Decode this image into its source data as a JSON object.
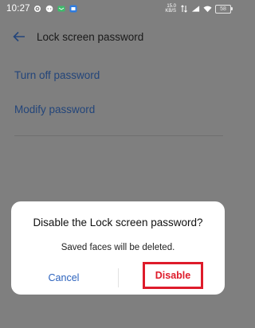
{
  "status_bar": {
    "time": "10:27",
    "net_speed_value": "15.0",
    "net_speed_unit": "KB/S",
    "battery": "58",
    "icons": [
      "settings-icon",
      "chat-icon",
      "message-icon",
      "app-icon",
      "network-speed-icon",
      "mobile-data-icon",
      "signal-icon",
      "wifi-icon",
      "battery-icon"
    ]
  },
  "header": {
    "title": "Lock screen password",
    "back_icon": "back-arrow-icon"
  },
  "menu": {
    "items": [
      {
        "label": "Turn off password"
      },
      {
        "label": "Modify password"
      }
    ]
  },
  "dialog": {
    "title": "Disable the Lock screen password?",
    "message": "Saved faces will be deleted.",
    "cancel_label": "Cancel",
    "disable_label": "Disable"
  },
  "colors": {
    "overlay": "#7f7f7f",
    "link_blue": "#23457a",
    "cancel_blue": "#2b62bd",
    "disable_red": "#de1b2a",
    "highlight_border": "#de1b2a"
  }
}
